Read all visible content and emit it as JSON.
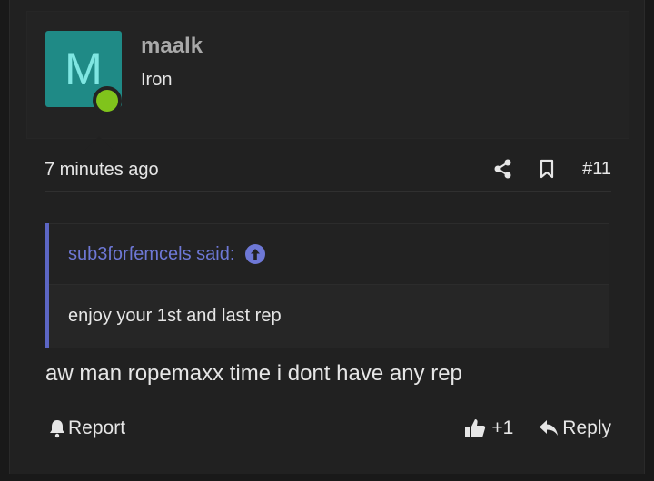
{
  "user": {
    "avatar_letter": "M",
    "avatar_color": "#1f8a86",
    "status_color": "#80c41c",
    "name": "maalk",
    "title": "Iron"
  },
  "meta": {
    "time": "7 minutes ago",
    "share_icon": "share-icon",
    "bookmark_icon": "bookmark-icon",
    "post_number": "#11"
  },
  "quote": {
    "author": "sub3forfemcels said:",
    "accent_color": "#5c66c4",
    "body": "enjoy your 1st and last rep"
  },
  "message": "aw man ropemaxx time i dont have any rep",
  "footer": {
    "report_label": "Report",
    "like_count": "+1",
    "reply_label": "Reply"
  }
}
